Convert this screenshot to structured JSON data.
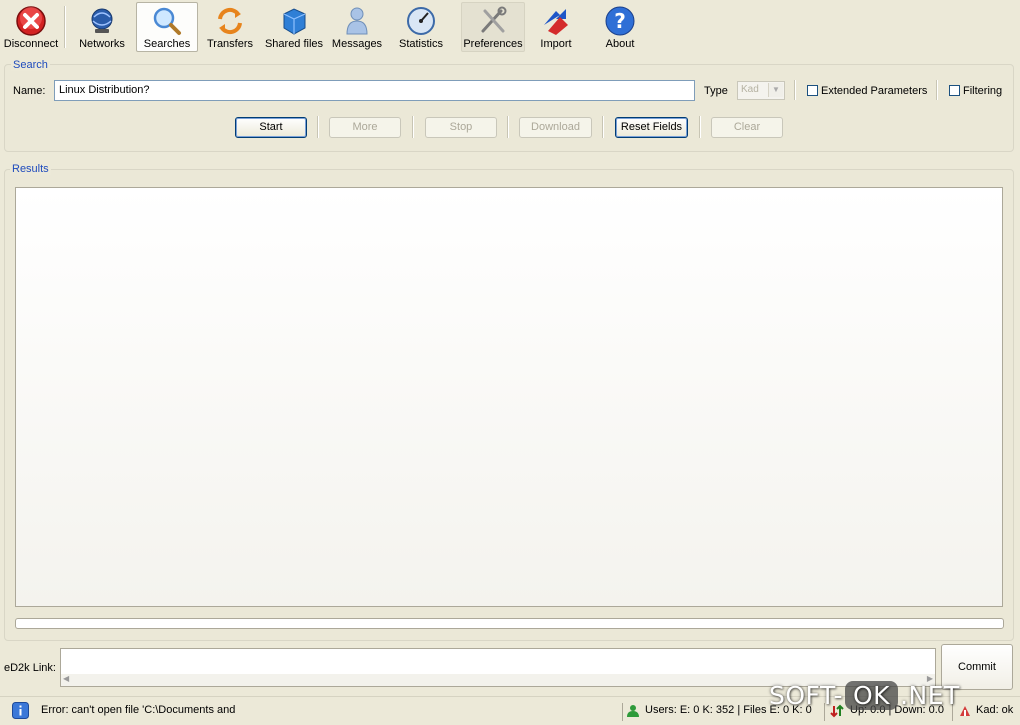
{
  "toolbar": {
    "disconnect": "Disconnect",
    "networks": "Networks",
    "searches": "Searches",
    "transfers": "Transfers",
    "shared_files": "Shared files",
    "messages": "Messages",
    "statistics": "Statistics",
    "preferences": "Preferences",
    "import": "Import",
    "about": "About",
    "active": "Searches"
  },
  "search": {
    "group_title": "Search",
    "name_label": "Name:",
    "name_value": "Linux Distribution?",
    "type_label": "Type",
    "type_value": "Kad",
    "extended_label": "Extended Parameters",
    "filtering_label": "Filtering",
    "buttons": {
      "start": "Start",
      "more": "More",
      "stop": "Stop",
      "download": "Download",
      "reset": "Reset Fields",
      "clear": "Clear"
    }
  },
  "results": {
    "group_title": "Results"
  },
  "ed2k": {
    "label": "eD2k Link:",
    "value": "",
    "commit": "Commit"
  },
  "status": {
    "message": "Error: can't open file 'C:\\Documents and",
    "users": "Users: E: 0 K: 352 | Files E: 0 K: 0",
    "transfer": "Up: 0.0 | Down: 0.0",
    "connection": "Kad: ok"
  },
  "watermark": {
    "left": "SOFT-",
    "box": "OK",
    "right": ".NET"
  },
  "colors": {
    "window_bg": "#ece9d8",
    "group_title": "#1f4bbd",
    "button_border": "#003c74"
  }
}
